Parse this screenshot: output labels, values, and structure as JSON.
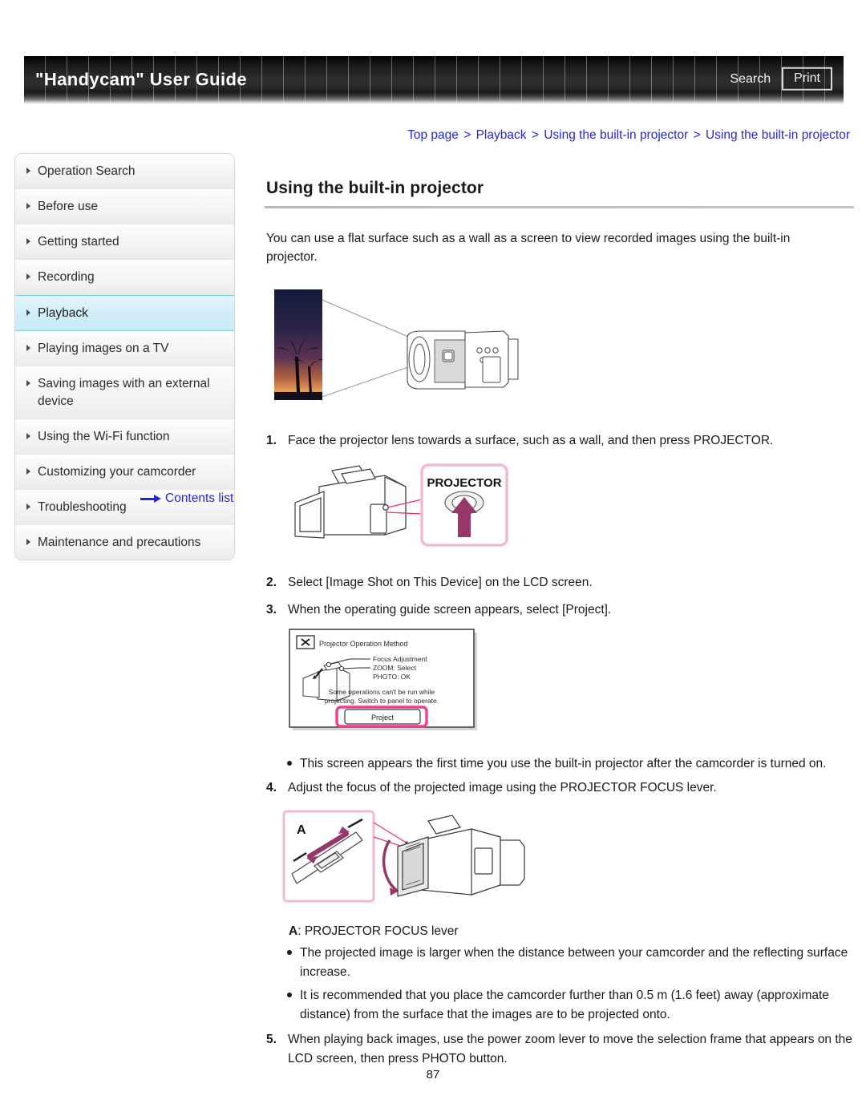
{
  "header": {
    "title": "\"Handycam\" User Guide",
    "search_label": "Search",
    "print_label": "Print"
  },
  "breadcrumb": {
    "items": [
      "Top page",
      "Playback",
      "Using the built-in projector",
      "Using the built-in projector"
    ],
    "separator": ">"
  },
  "sidebar": {
    "items": [
      {
        "label": "Operation Search",
        "active": false
      },
      {
        "label": "Before use",
        "active": false
      },
      {
        "label": "Getting started",
        "active": false
      },
      {
        "label": "Recording",
        "active": false
      },
      {
        "label": "Playback",
        "active": true
      },
      {
        "label": "Playing images on a TV",
        "active": false
      },
      {
        "label": "Saving images with an external device",
        "active": false
      },
      {
        "label": "Using the Wi-Fi function",
        "active": false
      },
      {
        "label": "Customizing your camcorder",
        "active": false
      },
      {
        "label": "Troubleshooting",
        "active": false
      },
      {
        "label": "Maintenance and precautions",
        "active": false
      }
    ],
    "contents_link": "Contents list"
  },
  "main": {
    "title": "Using the built-in projector",
    "intro": "You can use a flat surface such as a wall as a screen to view recorded images using the built-in projector.",
    "steps": {
      "s1_num": "1.",
      "s1_text": "Face the projector lens towards a surface, such as a wall, and then press PROJECTOR.",
      "s2_num": "2.",
      "s2_text": "Select [Image Shot on This Device] on the LCD screen.",
      "s3_num": "3.",
      "s3_text": "When the operating guide screen appears, select [Project].",
      "s4_num": "4.",
      "s4_text": "Adjust the focus of the projected image using the PROJECTOR FOCUS lever.",
      "s5_num": "5.",
      "s5_text": "When playing back images, use the power zoom lever to move the selection frame that appears on the LCD screen, then press PHOTO button."
    },
    "notes": {
      "note_first_time": "This screen appears the first time you use the built-in projector after the camcorder is turned on.",
      "note_larger": "The projected image is larger when the distance between your camcorder and the reflecting surface increase.",
      "note_distance": "It is recommended that you place the camcorder further than 0.5 m (1.6 feet) away (approximate distance) from the surface that the images are to be projected onto."
    },
    "lever_label_letter": "A",
    "lever_label_text": ": PROJECTOR FOCUS lever"
  },
  "figures": {
    "fig_projection": {
      "caption": "camcorder projecting image of palm trees at sunset onto a flat screen"
    },
    "fig_projector_button": {
      "button_text": "PROJECTOR",
      "caption": "camcorder with callout to PROJECTOR button and upward arrow"
    },
    "fig_lcd_guide": {
      "screen_title": "Projector Operation Method",
      "labels": [
        "Focus Adjustment",
        "ZOOM: Select",
        "PHOTO: OK"
      ],
      "body_line1": "Some operations can't be run while",
      "body_line2": "projecting. Switch to panel to operate.",
      "project_button": "Project"
    },
    "fig_focus_lever": {
      "letter": "A",
      "caption": "close-up of PROJECTOR FOCUS lever on camcorder with LCD panel rotating"
    }
  },
  "page_number": "87",
  "colors": {
    "link_blue": "#2727d6",
    "accent_pink": "#e8317f",
    "callout_pink": "#f2b9cf",
    "highlight_cyan": "#d2eef8",
    "header_dark": "#1c1c1c"
  }
}
